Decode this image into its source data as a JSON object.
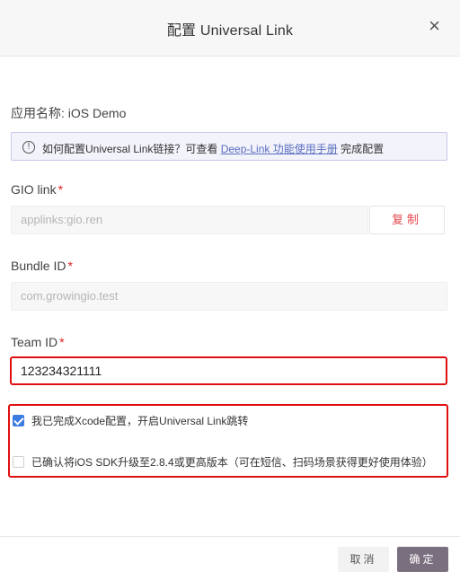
{
  "dialog": {
    "title": "配置 Universal Link",
    "close_symbol": "×"
  },
  "app_name": "应用名称: iOS Demo",
  "info": {
    "icon": "info-icon",
    "icon_glyph": "!",
    "prefix": "如何配置Universal Link链接？可查看 ",
    "link": "Deep-Link 功能使用手册",
    "suffix": " 完成配置"
  },
  "gio_link": {
    "label": "GIO link",
    "value": "applinks:gio.ren",
    "copy_label": "复制"
  },
  "bundle_id": {
    "label": "Bundle ID",
    "value": "com.growingio.test"
  },
  "team_id": {
    "label": "Team ID",
    "value": "123234321111"
  },
  "required_mark": "*",
  "checkboxes": [
    {
      "label": "我已完成Xcode配置，开启Universal Link跳转",
      "checked": true
    },
    {
      "label": "已确认将iOS SDK升级至2.8.4或更高版本（可在短信、扫码场景获得更好使用体验）",
      "checked": false
    }
  ],
  "footer": {
    "cancel_label": "取消",
    "confirm_label": "确定"
  },
  "colors": {
    "accent_red": "#e5474b",
    "highlight_border": "#e01010",
    "checkbox_blue": "#3d7ce0",
    "confirm_button": "#7a6f7f",
    "link": "#5a6fc0"
  }
}
